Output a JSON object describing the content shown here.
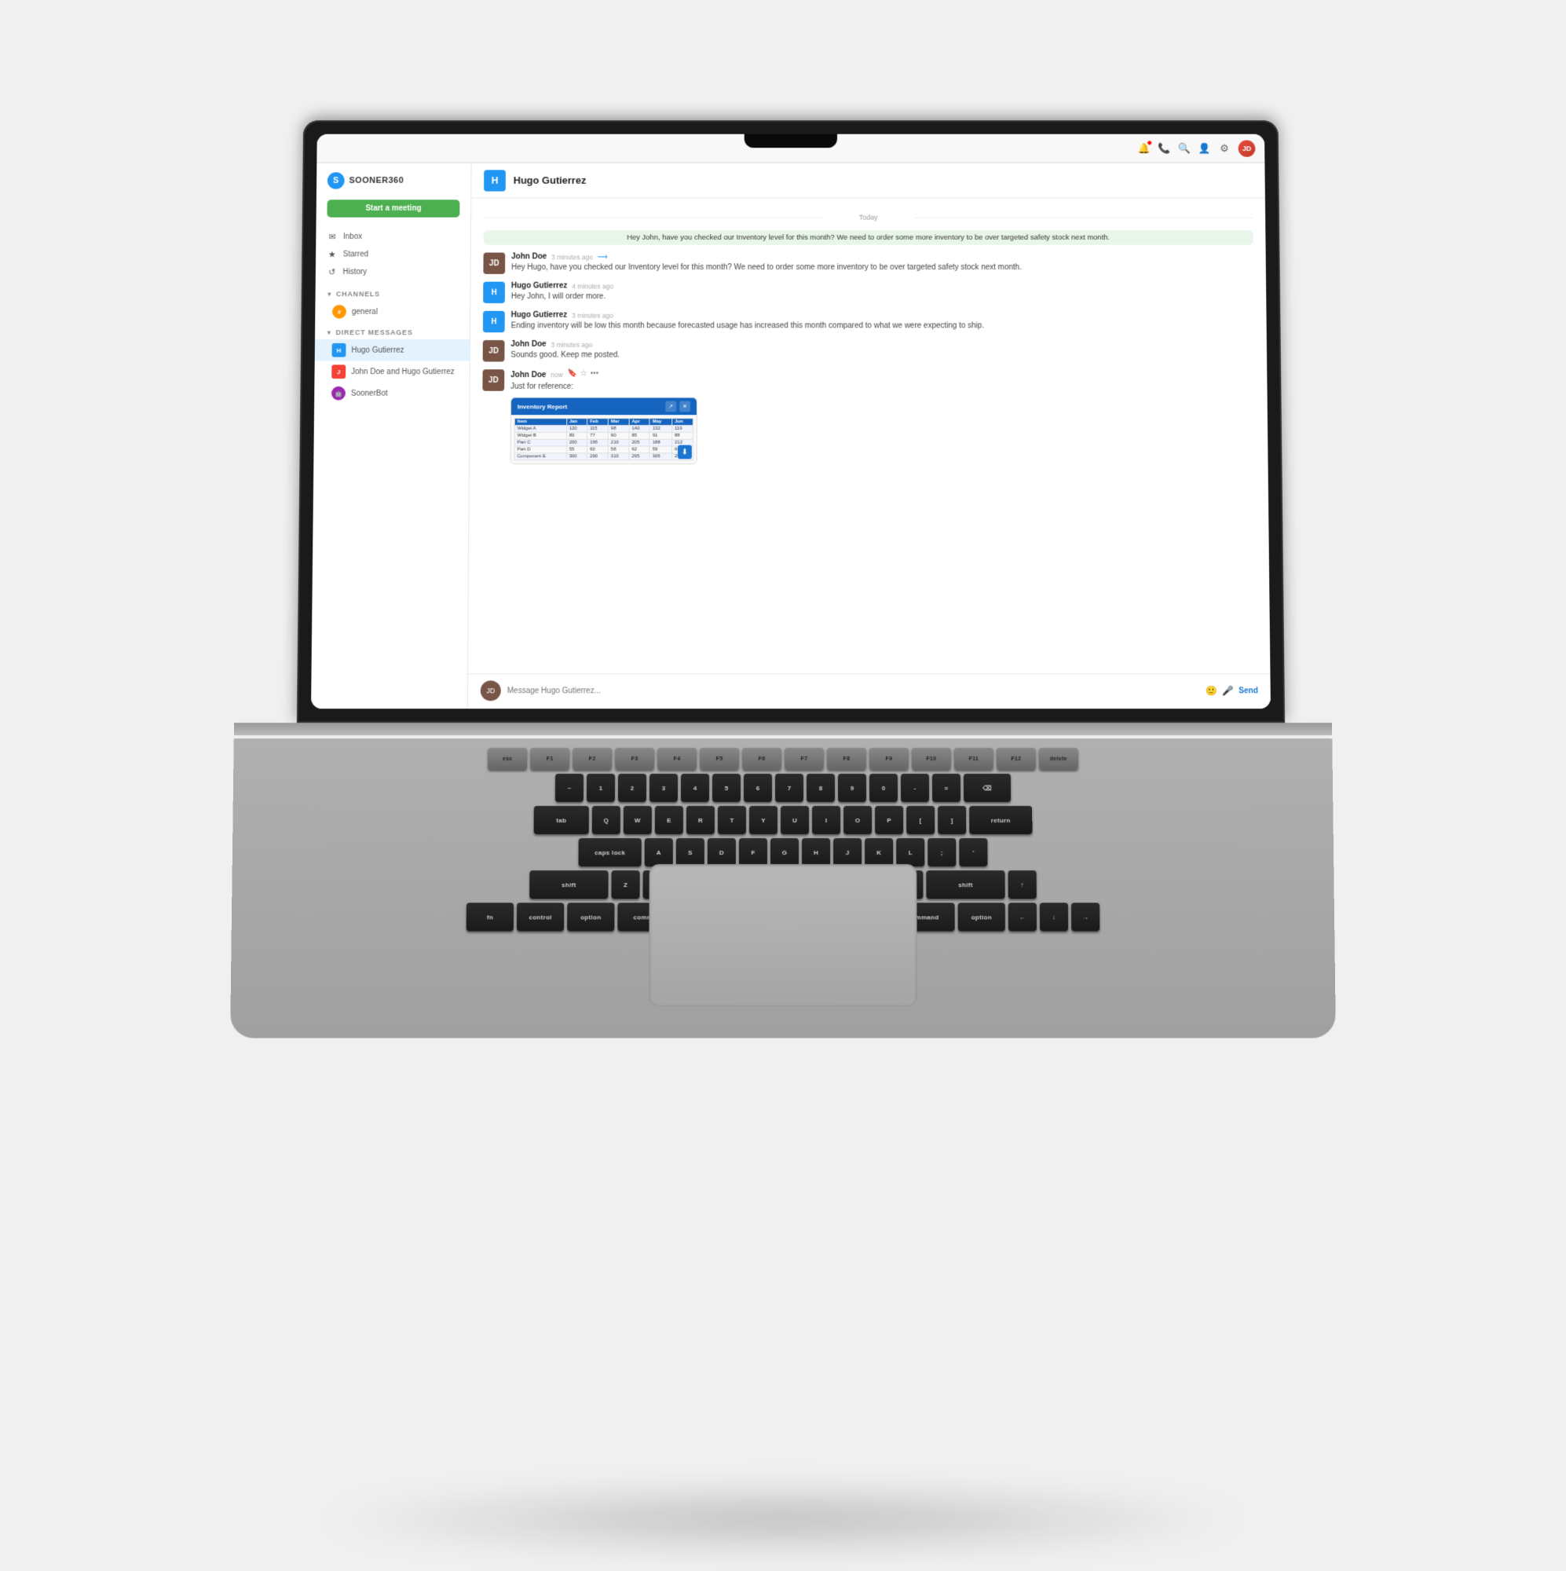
{
  "app": {
    "title": "SOONER360",
    "logo_letter": "S",
    "start_meeting_label": "Start a meeting"
  },
  "topbar": {
    "icons": [
      "bell",
      "phone",
      "search",
      "user-plus",
      "settings"
    ],
    "avatar_initials": "JD"
  },
  "sidebar": {
    "nav_items": [
      {
        "label": "Inbox",
        "icon": "✉"
      },
      {
        "label": "Starred",
        "icon": "★"
      },
      {
        "label": "History",
        "icon": "↺"
      }
    ],
    "channels_section": "CHANNELS",
    "channels": [
      {
        "label": "general",
        "icon": "#"
      }
    ],
    "dm_section": "DIRECT MESSAGES",
    "dm_items": [
      {
        "label": "Hugo Gutierrez",
        "avatar": "H",
        "color": "#2196F3",
        "active": true
      },
      {
        "label": "John Doe and Hugo Gutierrez",
        "avatar": "J",
        "color": "#F44336",
        "active": false
      }
    ],
    "bot": {
      "label": "SoonerBot",
      "icon": "🤖"
    }
  },
  "chat": {
    "header": {
      "avatar": "H",
      "name": "Hugo Gutierrez"
    },
    "date_divider": "Today",
    "highlighted_message": "Hey John, have you checked our Inventory level for this month? We need to order some more inventory to be over targeted safety stock next month.",
    "messages": [
      {
        "sender": "John Doe",
        "time": "3 minutes ago",
        "avatar": "JD",
        "avatar_color": "#795548",
        "text": "Hey Hugo, have you checked our Inventory level for this month? We need to order some more inventory to be over targeted safety stock next month.",
        "forwarded": true
      },
      {
        "sender": "Hugo Gutierrez",
        "time": "4 minutes ago",
        "avatar": "H",
        "avatar_color": "#2196F3",
        "text": "Hey John, I will order more."
      },
      {
        "sender": "Hugo Gutierrez",
        "time": "3 minutes ago",
        "avatar": "H",
        "avatar_color": "#2196F3",
        "text": "Ending inventory will be low this month because forecasted usage has increased this month compared to what we were expecting to ship."
      },
      {
        "sender": "John Doe",
        "time": "3 minutes ago",
        "avatar": "JD",
        "avatar_color": "#795548",
        "text": "Sounds good. Keep me posted."
      },
      {
        "sender": "John Doe",
        "time": "now",
        "avatar": "JD",
        "avatar_color": "#795548",
        "text": "Just for reference:",
        "has_attachment": true
      }
    ],
    "attachment": {
      "title": "Inventory Report",
      "headers": [
        "Item",
        "Jan",
        "Feb",
        "Mar",
        "Apr",
        "May",
        "Jun"
      ],
      "rows": [
        [
          "Widget A",
          "120",
          "115",
          "98",
          "140",
          "132",
          "119"
        ],
        [
          "Widget B",
          "80",
          "77",
          "90",
          "85",
          "91",
          "88"
        ],
        [
          "Part C",
          "200",
          "195",
          "210",
          "205",
          "188",
          "212"
        ],
        [
          "Part D",
          "55",
          "60",
          "58",
          "62",
          "59",
          "64"
        ],
        [
          "Component E",
          "300",
          "290",
          "310",
          "295",
          "305",
          "298"
        ]
      ]
    },
    "input_placeholder": "Message Hugo Gutierrez..."
  }
}
